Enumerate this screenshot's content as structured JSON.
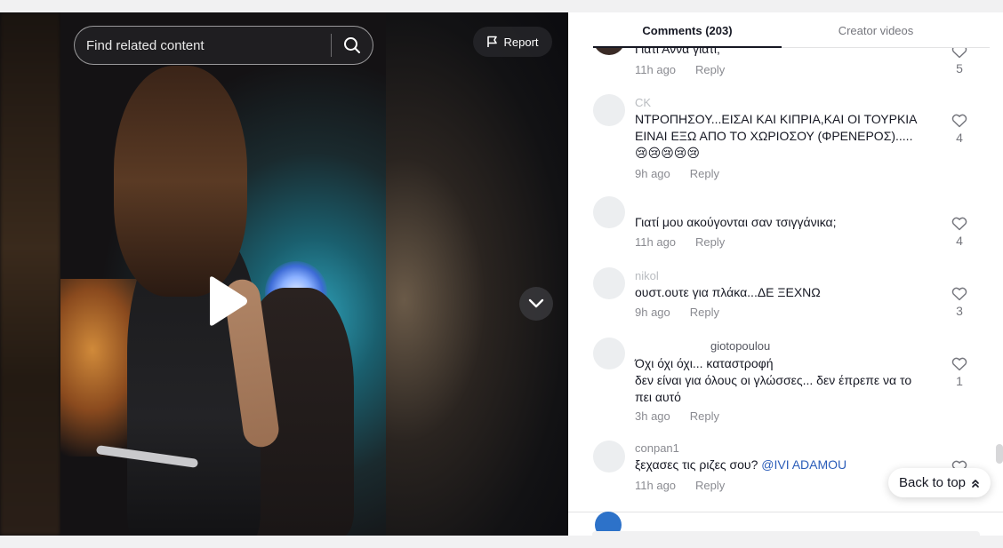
{
  "search": {
    "placeholder": "Find related content"
  },
  "report": {
    "label": "Report"
  },
  "tabs": [
    {
      "label": "Comments (203)",
      "active": true
    },
    {
      "label": "Creator videos",
      "active": false
    }
  ],
  "comments": [
    {
      "user": "",
      "text": "Γιατί Άννα γιατί;",
      "time": "11h ago",
      "reply": "Reply",
      "likes": "5"
    },
    {
      "user": "CK",
      "text": "ΝΤΡΟΠΗΣΟΥ...ΕΙΣΑΙ ΚΑΙ ΚΙΠΡΙΑ,ΚΑΙ ΟΙ ΤΟΥΡΚΙΑ\nΕΙΝΑΙ ΕΞΩ ΑΠΟ ΤΟ ΧΩΡΙΟΣΟΥ (ΦΡΕΝΕΡΟΣ).....\n😢😢😢😢😢",
      "time": "9h ago",
      "reply": "Reply",
      "likes": "4"
    },
    {
      "user": "",
      "text": "Γιατί μου ακούγονται σαν τσιγγάνικα;",
      "time": "11h ago",
      "reply": "Reply",
      "likes": "4"
    },
    {
      "user": "nikol",
      "text": "ουστ.ουτε για πλάκα...ΔΕ ΞΕΧΝΩ",
      "time": "9h ago",
      "reply": "Reply",
      "likes": "3"
    },
    {
      "user": "giotopoulou",
      "text": "Όχι όχι όχι... καταστροφή\nδεν είναι για όλους οι γλώσσες... δεν έπρεπε να το\nπει αυτό",
      "time": "3h ago",
      "reply": "Reply",
      "likes": "1"
    },
    {
      "user": "conpan1",
      "text": "ξεχασες τις ριζες σου? ",
      "mention": "@IVI ADAMOU",
      "time": "11h ago",
      "reply": "Reply",
      "likes": ""
    }
  ],
  "back_to_top": {
    "label": "Back to top"
  },
  "colors": {
    "accent_text": "#161823",
    "muted": "#8a8b91",
    "mention": "#2b5db9"
  }
}
